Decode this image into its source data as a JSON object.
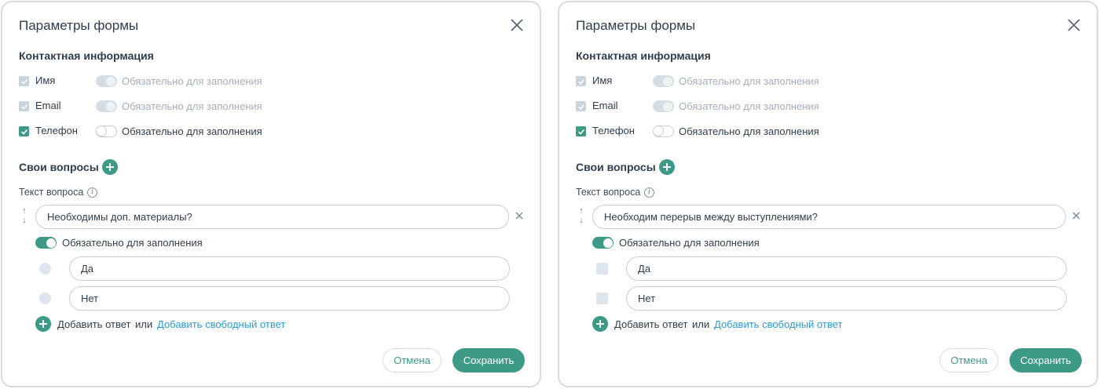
{
  "panels": [
    {
      "title": "Параметры формы",
      "contacts_title": "Контактная информация",
      "contacts": [
        {
          "label": "Имя",
          "required_label": "Обязательно для заполнения"
        },
        {
          "label": "Email",
          "required_label": "Обязательно для заполнения"
        },
        {
          "label": "Телефон",
          "required_label": "Обязательно для заполнения"
        }
      ],
      "own_questions_title": "Свои вопросы",
      "question_label": "Текст вопроса",
      "question_value": "Необходимы доп. материалы?",
      "question_required_label": "Обязательно для заполнения",
      "answer_type": "radio",
      "answers": [
        "Да",
        "Нет"
      ],
      "add_answer": "Добавить ответ",
      "or": "или",
      "add_free_answer": "Добавить свободный ответ",
      "cancel": "Отмена",
      "save": "Сохранить"
    },
    {
      "title": "Параметры формы",
      "contacts_title": "Контактная информация",
      "contacts": [
        {
          "label": "Имя",
          "required_label": "Обязательно для заполнения"
        },
        {
          "label": "Email",
          "required_label": "Обязательно для заполнения"
        },
        {
          "label": "Телефон",
          "required_label": "Обязательно для заполнения"
        }
      ],
      "own_questions_title": "Свои вопросы",
      "question_label": "Текст вопроса",
      "question_value": "Необходим перерыв между выступлениями?",
      "question_required_label": "Обязательно для заполнения",
      "answer_type": "checkbox",
      "answers": [
        "Да",
        "Нет"
      ],
      "add_answer": "Добавить ответ",
      "or": "или",
      "add_free_answer": "Добавить свободный ответ",
      "cancel": "Отмена",
      "save": "Сохранить"
    }
  ],
  "colors": {
    "accent": "#3d9a87",
    "link": "#2a9bd8",
    "muted": "#a4b0bc"
  }
}
